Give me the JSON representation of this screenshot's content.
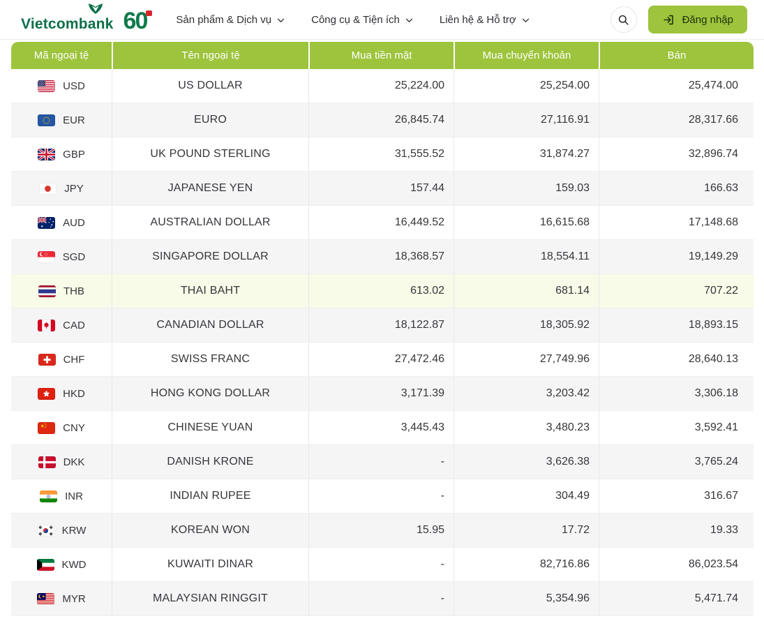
{
  "header": {
    "brand": "Vietcombank",
    "anniversary": "60",
    "nav": [
      {
        "label": "Sản phẩm & Dịch vụ"
      },
      {
        "label": "Công cụ & Tiện ích"
      },
      {
        "label": "Liên hệ & Hỗ trợ"
      }
    ],
    "login_label": "Đăng nhập"
  },
  "colors": {
    "accent_green": "#9dc43c",
    "brand_green": "#0d6f49",
    "row_alt": "#f5f5f6",
    "row_highlight": "#f7fbe7"
  },
  "table": {
    "columns": [
      "Mã ngoại tệ",
      "Tên ngoại tệ",
      "Mua tiền mặt",
      "Mua chuyển khoản",
      "Bán"
    ],
    "rows": [
      {
        "code": "USD",
        "name": "US DOLLAR",
        "cash": "25,224.00",
        "transfer": "25,254.00",
        "sell": "25,474.00"
      },
      {
        "code": "EUR",
        "name": "EURO",
        "cash": "26,845.74",
        "transfer": "27,116.91",
        "sell": "28,317.66"
      },
      {
        "code": "GBP",
        "name": "UK POUND STERLING",
        "cash": "31,555.52",
        "transfer": "31,874.27",
        "sell": "32,896.74"
      },
      {
        "code": "JPY",
        "name": "JAPANESE YEN",
        "cash": "157.44",
        "transfer": "159.03",
        "sell": "166.63"
      },
      {
        "code": "AUD",
        "name": "AUSTRALIAN DOLLAR",
        "cash": "16,449.52",
        "transfer": "16,615.68",
        "sell": "17,148.68"
      },
      {
        "code": "SGD",
        "name": "SINGAPORE DOLLAR",
        "cash": "18,368.57",
        "transfer": "18,554.11",
        "sell": "19,149.29"
      },
      {
        "code": "THB",
        "name": "THAI BAHT",
        "cash": "613.02",
        "transfer": "681.14",
        "sell": "707.22"
      },
      {
        "code": "CAD",
        "name": "CANADIAN DOLLAR",
        "cash": "18,122.87",
        "transfer": "18,305.92",
        "sell": "18,893.15"
      },
      {
        "code": "CHF",
        "name": "SWISS FRANC",
        "cash": "27,472.46",
        "transfer": "27,749.96",
        "sell": "28,640.13"
      },
      {
        "code": "HKD",
        "name": "HONG KONG DOLLAR",
        "cash": "3,171.39",
        "transfer": "3,203.42",
        "sell": "3,306.18"
      },
      {
        "code": "CNY",
        "name": "CHINESE YUAN",
        "cash": "3,445.43",
        "transfer": "3,480.23",
        "sell": "3,592.41"
      },
      {
        "code": "DKK",
        "name": "DANISH KRONE",
        "cash": "-",
        "transfer": "3,626.38",
        "sell": "3,765.24"
      },
      {
        "code": "INR",
        "name": "INDIAN RUPEE",
        "cash": "-",
        "transfer": "304.49",
        "sell": "316.67"
      },
      {
        "code": "KRW",
        "name": "KOREAN WON",
        "cash": "15.95",
        "transfer": "17.72",
        "sell": "19.33"
      },
      {
        "code": "KWD",
        "name": "KUWAITI DINAR",
        "cash": "-",
        "transfer": "82,716.86",
        "sell": "86,023.54"
      },
      {
        "code": "MYR",
        "name": "MALAYSIAN RINGGIT",
        "cash": "-",
        "transfer": "5,354.96",
        "sell": "5,471.74"
      }
    ]
  }
}
